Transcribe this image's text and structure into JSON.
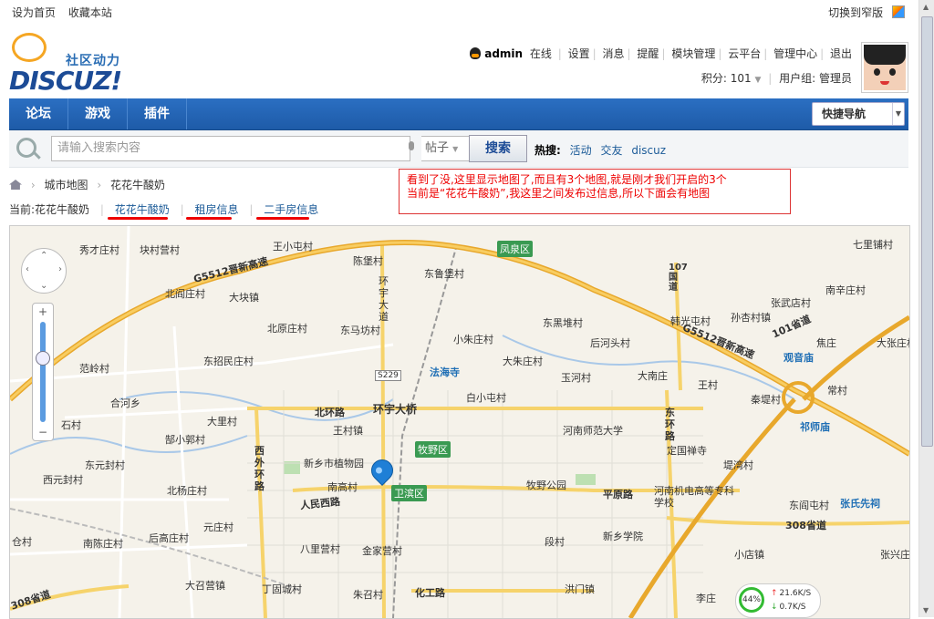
{
  "topbar": {
    "set_home": "设为首页",
    "bookmark": "收藏本站",
    "switch_width": "切换到窄版"
  },
  "logo": {
    "slogan": "社区动力",
    "wordmark": "DISCUZ!"
  },
  "user": {
    "name": "admin",
    "status": "在线",
    "links": [
      "设置",
      "消息",
      "提醒",
      "模块管理",
      "云平台",
      "管理中心",
      "退出"
    ],
    "points_label": "积分: 101",
    "group_label": "用户组: 管理员"
  },
  "nav": {
    "items": [
      "论坛",
      "游戏",
      "插件"
    ],
    "quick_nav": "快捷导航"
  },
  "search": {
    "placeholder": "请输入搜索内容",
    "type": "帖子",
    "button": "搜索",
    "hot_label": "热搜:",
    "hot_terms": [
      "活动",
      "交友",
      "discuz"
    ]
  },
  "breadcrumb": [
    "城市地图",
    "花花牛酸奶"
  ],
  "tabs": {
    "current": "当前:花花牛酸奶",
    "items": [
      "花花牛酸奶",
      "租房信息",
      "二手房信息"
    ]
  },
  "annotation": {
    "line1": "看到了没,这里显示地图了,而且有3个地图,就是刚才我们开启的3个",
    "line2": "当前是“花花牛酸奶”,我这里之间发布过信息,所以下面会有地图"
  },
  "map": {
    "highway": "G5512晋新高速",
    "highway2": "G5512晋新高速",
    "districts": [
      "凤泉区",
      "牧野区",
      "卫滨区"
    ],
    "places": [
      {
        "t": "秀才庄村"
      },
      {
        "t": "块村营村"
      },
      {
        "t": "王小屯村"
      },
      {
        "t": "七里铺村"
      },
      {
        "t": "陈堡村"
      },
      {
        "t": "东鲁堡村"
      },
      {
        "t": "北阎庄村"
      },
      {
        "t": "大块镇"
      },
      {
        "t": "环宇大道"
      },
      {
        "t": "张武店村"
      },
      {
        "t": "南辛庄村"
      },
      {
        "t": "北原庄村"
      },
      {
        "t": "东马坊村"
      },
      {
        "t": "小朱庄村"
      },
      {
        "t": "东黑堆村"
      },
      {
        "t": "韩光屯村"
      },
      {
        "t": "孙杏村镇"
      },
      {
        "t": "101省道"
      },
      {
        "t": "东招民庄村"
      },
      {
        "t": "大朱庄村"
      },
      {
        "t": "后河头村"
      },
      {
        "t": "焦庄"
      },
      {
        "t": "大张庄村"
      },
      {
        "t": "观音庙"
      },
      {
        "t": "范岭村"
      },
      {
        "t": "法海寺"
      },
      {
        "t": "玉河村"
      },
      {
        "t": "大南庄"
      },
      {
        "t": "王村"
      },
      {
        "t": "合河乡"
      },
      {
        "t": "白小屯村"
      },
      {
        "t": "秦堤村"
      },
      {
        "t": "常村"
      },
      {
        "t": "北环路"
      },
      {
        "t": "环宇大桥"
      },
      {
        "t": "大里村"
      },
      {
        "t": "石村"
      },
      {
        "t": "王村镇"
      },
      {
        "t": "河南师范大学"
      },
      {
        "t": "东环路"
      },
      {
        "t": "祁师庙"
      },
      {
        "t": "郜小郭村"
      },
      {
        "t": "定国禅寺"
      },
      {
        "t": "西外环路"
      },
      {
        "t": "新乡市植物园"
      },
      {
        "t": "东元封村"
      },
      {
        "t": "堤湾村"
      },
      {
        "t": "西元封村"
      },
      {
        "t": "南高村"
      },
      {
        "t": "牧野公园"
      },
      {
        "t": "平原路"
      },
      {
        "t": "河南机电高等专科学校"
      },
      {
        "t": "北杨庄村"
      },
      {
        "t": "人民西路"
      },
      {
        "t": "东阎屯村"
      },
      {
        "t": "张氏先祠"
      },
      {
        "t": "元庄村"
      },
      {
        "t": "新乡学院"
      },
      {
        "t": "308省道"
      },
      {
        "t": "后高庄村"
      },
      {
        "t": "仓村"
      },
      {
        "t": "南陈庄村"
      },
      {
        "t": "八里营村"
      },
      {
        "t": "金家营村"
      },
      {
        "t": "段村"
      },
      {
        "t": "小店镇"
      },
      {
        "t": "张兴庄"
      },
      {
        "t": "大召营镇"
      },
      {
        "t": "丁固城村"
      },
      {
        "t": "洪门镇"
      },
      {
        "t": "朱召村"
      },
      {
        "t": "化工路"
      },
      {
        "t": "李庄"
      },
      {
        "t": "S229"
      },
      {
        "t": "107国道"
      },
      {
        "t": "308省道"
      }
    ]
  },
  "traffic": {
    "percent": "44%",
    "up": "21.6K/S",
    "down": "0.7K/S"
  }
}
